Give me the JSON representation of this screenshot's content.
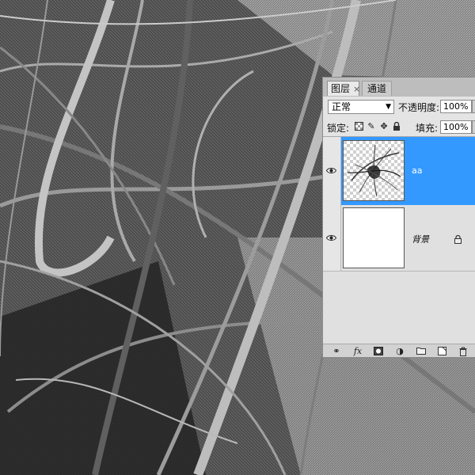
{
  "panel": {
    "tabs": [
      {
        "label": "图层",
        "close": "×",
        "active": true
      },
      {
        "label": "通道",
        "active": false
      }
    ],
    "blend_mode": "正常",
    "opacity_label": "不透明度:",
    "opacity_value": "100%",
    "lock_label": "锁定:",
    "fill_label": "填充:",
    "fill_value": "100%",
    "lock_icons": [
      "lock-transparent-icon",
      "lock-image-icon",
      "lock-position-icon",
      "lock-all-icon"
    ],
    "layers": [
      {
        "name": "aa",
        "visible": true,
        "selected": true,
        "thumbnail": "transparent-fractal"
      },
      {
        "name": "背景",
        "visible": true,
        "selected": false,
        "locked": true,
        "thumbnail": "white"
      }
    ],
    "bottom_icons": [
      "link-icon",
      "fx-icon",
      "mask-icon",
      "adjustment-icon",
      "folder-icon",
      "new-layer-icon",
      "trash-icon"
    ],
    "fx_label": "fx",
    "selected_color": "#3399ff"
  }
}
